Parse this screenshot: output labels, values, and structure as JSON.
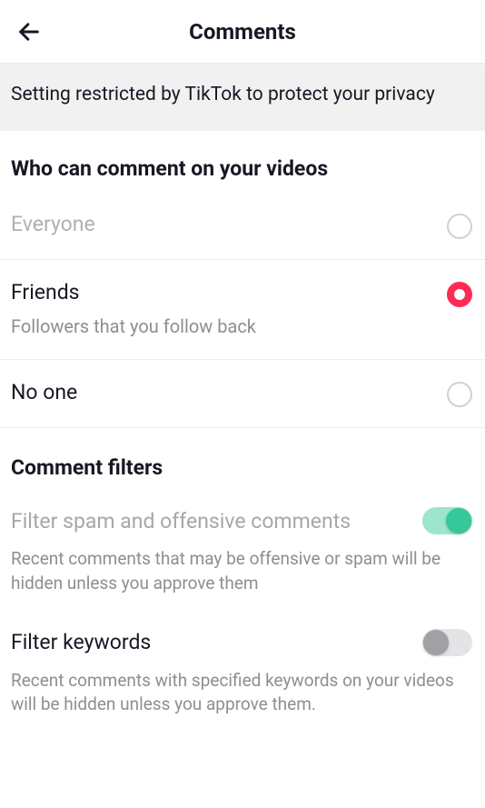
{
  "header": {
    "title": "Comments"
  },
  "banner": {
    "text": "Setting restricted by TikTok to protect your privacy"
  },
  "whoCanComment": {
    "title": "Who can comment on your videos",
    "options": [
      {
        "label": "Everyone",
        "desc": "",
        "selected": false,
        "disabled": true
      },
      {
        "label": "Friends",
        "desc": "Followers that you follow back",
        "selected": true,
        "disabled": false
      },
      {
        "label": "No one",
        "desc": "",
        "selected": false,
        "disabled": false
      }
    ]
  },
  "commentFilters": {
    "title": "Comment filters",
    "filters": [
      {
        "label": "Filter spam and offensive comments",
        "desc": "Recent comments that may be offensive or spam will be hidden unless you approve them",
        "on": true,
        "labelDisabled": true
      },
      {
        "label": "Filter keywords",
        "desc": "Recent comments with specified keywords on your videos will be hidden unless you approve them.",
        "on": false,
        "labelDisabled": false
      }
    ]
  }
}
